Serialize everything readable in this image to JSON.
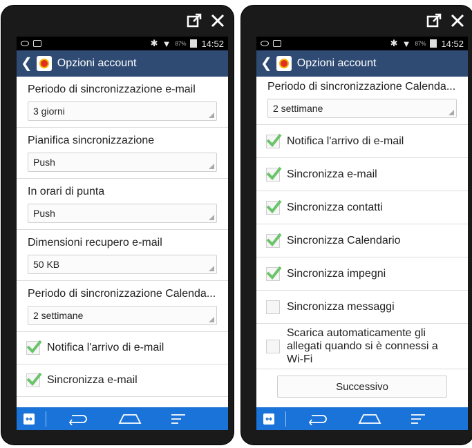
{
  "status": {
    "time": "14:52",
    "battery": "87%"
  },
  "actionbar": {
    "title": "Opzioni account"
  },
  "left": {
    "settings": [
      {
        "label": "Periodo di sincronizzazione e-mail",
        "value": "3 giorni"
      },
      {
        "label": "Pianifica sincronizzazione",
        "value": "Push"
      },
      {
        "label": "In orari di punta",
        "value": "Push"
      },
      {
        "label": "Dimensioni recupero e-mail",
        "value": "50 KB"
      },
      {
        "label": "Periodo di sincronizzazione Calenda...",
        "value": "2 settimane"
      }
    ],
    "checks": [
      {
        "label": "Notifica l'arrivo di e-mail",
        "checked": true
      },
      {
        "label": "Sincronizza e-mail",
        "checked": true
      }
    ]
  },
  "right": {
    "settings": [
      {
        "label": "Periodo di sincronizzazione Calenda...",
        "value": "2 settimane"
      }
    ],
    "checks": [
      {
        "label": "Notifica l'arrivo di e-mail",
        "checked": true
      },
      {
        "label": "Sincronizza e-mail",
        "checked": true
      },
      {
        "label": "Sincronizza contatti",
        "checked": true
      },
      {
        "label": "Sincronizza Calendario",
        "checked": true
      },
      {
        "label": "Sincronizza impegni",
        "checked": true
      },
      {
        "label": "Sincronizza messaggi",
        "checked": false
      },
      {
        "label": "Scarica automaticamente gli allegati quando si è connessi a Wi-Fi",
        "checked": false
      }
    ],
    "next_label": "Successivo"
  },
  "colors": {
    "actionbar": "#2f4b73",
    "navbar": "#1a73d8",
    "check": "#6ac46a"
  },
  "icons": [
    "open-in-new-icon",
    "close-icon",
    "back-icon",
    "home-icon",
    "menu-icon",
    "app-switch-icon"
  ]
}
